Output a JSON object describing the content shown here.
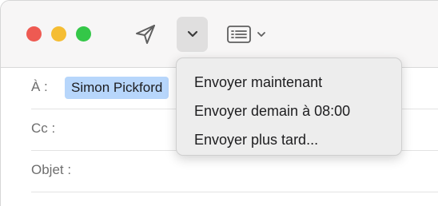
{
  "window": {
    "traffic_lights": [
      "close",
      "minimize",
      "maximize"
    ]
  },
  "toolbar": {
    "send_icon": "paper-plane-icon",
    "send_later_icon": "chevron-down-icon",
    "format_icon": "header-fields-icon"
  },
  "fields": {
    "to_label": "À :",
    "to_recipient": "Simon Pickford",
    "cc_label": "Cc :",
    "subject_label": "Objet :"
  },
  "send_menu": {
    "items": [
      "Envoyer maintenant",
      "Envoyer demain à 08:00",
      "Envoyer plus tard..."
    ]
  },
  "colors": {
    "close": "#ee5a52",
    "minimize": "#f5bd33",
    "maximize": "#34c748",
    "token_bg": "#b7d6fb"
  }
}
